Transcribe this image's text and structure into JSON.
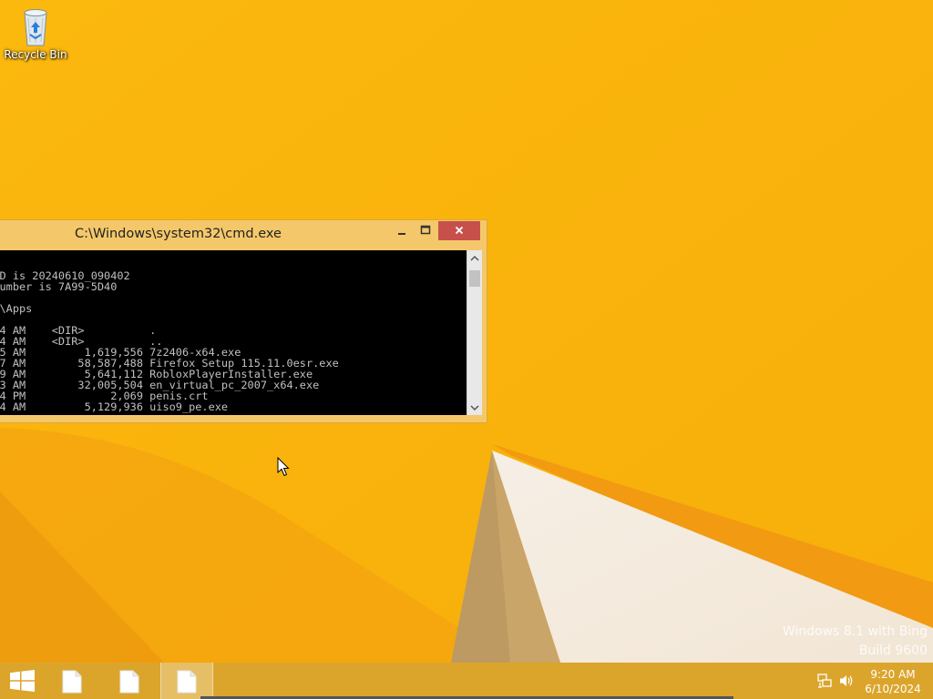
{
  "desktop": {
    "icons": [
      {
        "label": "Recycle Bin",
        "icon": "recycle-bin-icon"
      }
    ],
    "watermark": {
      "line1": "Windows 8.1 with Bing",
      "line2": "Build 9600"
    },
    "colors": {
      "wallpaper": "#f7b20b",
      "taskbar": "#d8a430",
      "accent_close": "#c7504b"
    }
  },
  "window": {
    "title": "C:\\Windows\\system32\\cmd.exe",
    "controls": {
      "minimize": "‒",
      "maximize": "□",
      "close": "✕"
    },
    "console_lines": [
      "D is 20240610_090402",
      "umber is 7A99-5D40",
      "",
      "\\Apps",
      "",
      "4 AM    <DIR>          .",
      "4 AM    <DIR>          ..",
      "5 AM         1,619,556 7z2406-x64.exe",
      "7 AM        58,587,488 Firefox Setup 115.11.0esr.exe",
      "9 AM         5,641,112 RobloxPlayerInstaller.exe",
      "3 AM        32,005,504 en_virtual_pc_2007_x64.exe",
      "4 PM             2,069 penis.crt",
      "4 AM         5,129,936 uiso9_pe.exe"
    ]
  },
  "taskbar": {
    "start_icon": "windows-logo-icon",
    "apps": [
      {
        "icon": "document-icon",
        "active": false
      },
      {
        "icon": "document-icon",
        "active": false
      },
      {
        "icon": "document-icon",
        "active": true
      }
    ],
    "tray": {
      "network_icon": "network-icon",
      "volume_icon": "speaker-icon",
      "time": "9:20 AM",
      "date": "6/10/2024"
    }
  }
}
